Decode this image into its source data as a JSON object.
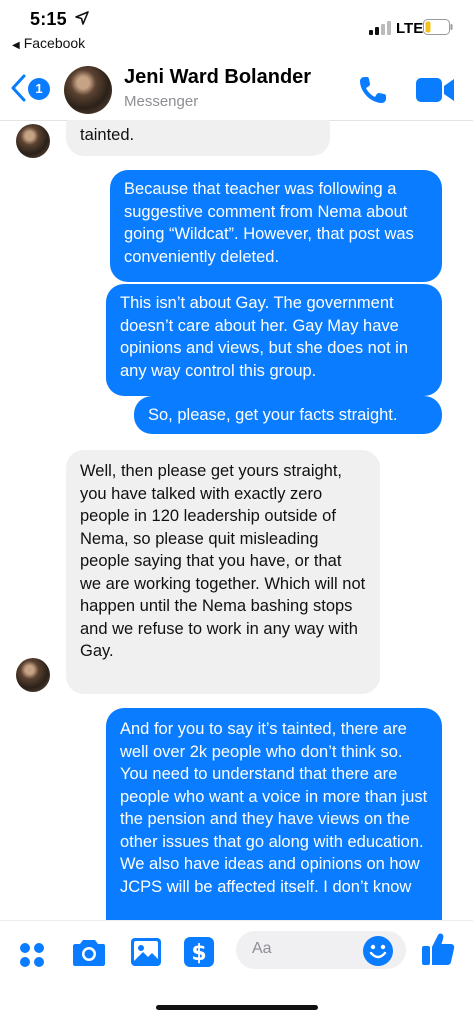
{
  "status_bar": {
    "time": "5:15",
    "back_app": "Facebook",
    "network": "LTE"
  },
  "header": {
    "badge_count": "1",
    "contact_name": "Jeni Ward Bolander",
    "subtitle": "Messenger"
  },
  "messages": [
    {
      "direction": "incoming",
      "text": "tainted."
    },
    {
      "direction": "outgoing",
      "text": "Because that teacher was following a suggestive comment from Nema about going “Wildcat”. However, that post was conveniently deleted."
    },
    {
      "direction": "outgoing",
      "text": "This isn’t about Gay. The government doesn’t care about her. Gay May have opinions and views, but she does not in any way control this group."
    },
    {
      "direction": "outgoing",
      "text": "So, please, get your facts straight."
    },
    {
      "direction": "incoming",
      "text": "Well, then please get yours straight, you have talked with exactly zero people in 120 leadership outside of Nema, so please quit misleading people saying that you have, or that we are working together. Which will not happen until the Nema bashing stops and we refuse to work in any way with Gay."
    },
    {
      "direction": "outgoing",
      "text": "And for you to say it’s tainted, there are well over 2k people who don’t think so. You need to understand that there are people who want a voice in more than just the pension and they have views on the other issues that go along with education. We also have ideas and opinions on how JCPS will be affected itself. I don’t know"
    }
  ],
  "composer": {
    "placeholder": "Aa"
  },
  "colors": {
    "accent": "#0a7cff",
    "incoming_bubble": "#f1f0f0"
  },
  "icons": [
    "location-arrow-icon",
    "signal-icon",
    "battery-icon",
    "back-chevron-icon",
    "phone-icon",
    "video-icon",
    "apps-grid-icon",
    "camera-icon",
    "photo-icon",
    "payment-icon",
    "emoji-icon",
    "thumbs-up-icon"
  ]
}
